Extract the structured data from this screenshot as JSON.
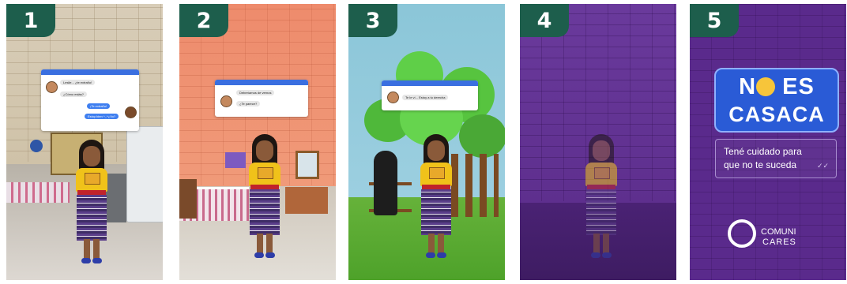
{
  "panels": [
    {
      "number": "1",
      "chat": [
        {
          "side": "in",
          "text": "Leslie... ¿te extraño!"
        },
        {
          "side": "in",
          "text": "¿Cómo estás?"
        },
        {
          "side": "out",
          "text": "¡Te extraño!"
        },
        {
          "side": "out",
          "text": "Estoy bien ^_^¿Vo?"
        }
      ]
    },
    {
      "number": "2",
      "chat": [
        {
          "side": "in",
          "text": "Deberíamos de vernos"
        },
        {
          "side": "in",
          "text": "¿Te parece?"
        }
      ]
    },
    {
      "number": "3",
      "chat": [
        {
          "side": "in",
          "text": "Te le ví... Estoy a tu derecha"
        }
      ]
    },
    {
      "number": "4"
    },
    {
      "number": "5",
      "title_line1": "NO ES",
      "title_line2": "CASACA",
      "emoji": "😔",
      "message": "Tené cuidado para que no te suceda",
      "checks": "✓✓",
      "brand_line1": "COMUNI",
      "brand_line2": "CARES"
    }
  ],
  "colors": {
    "badge": "#1d5e4c",
    "chat_bar": "#3a6fe0",
    "brand_purple": "#5a2a8c"
  }
}
